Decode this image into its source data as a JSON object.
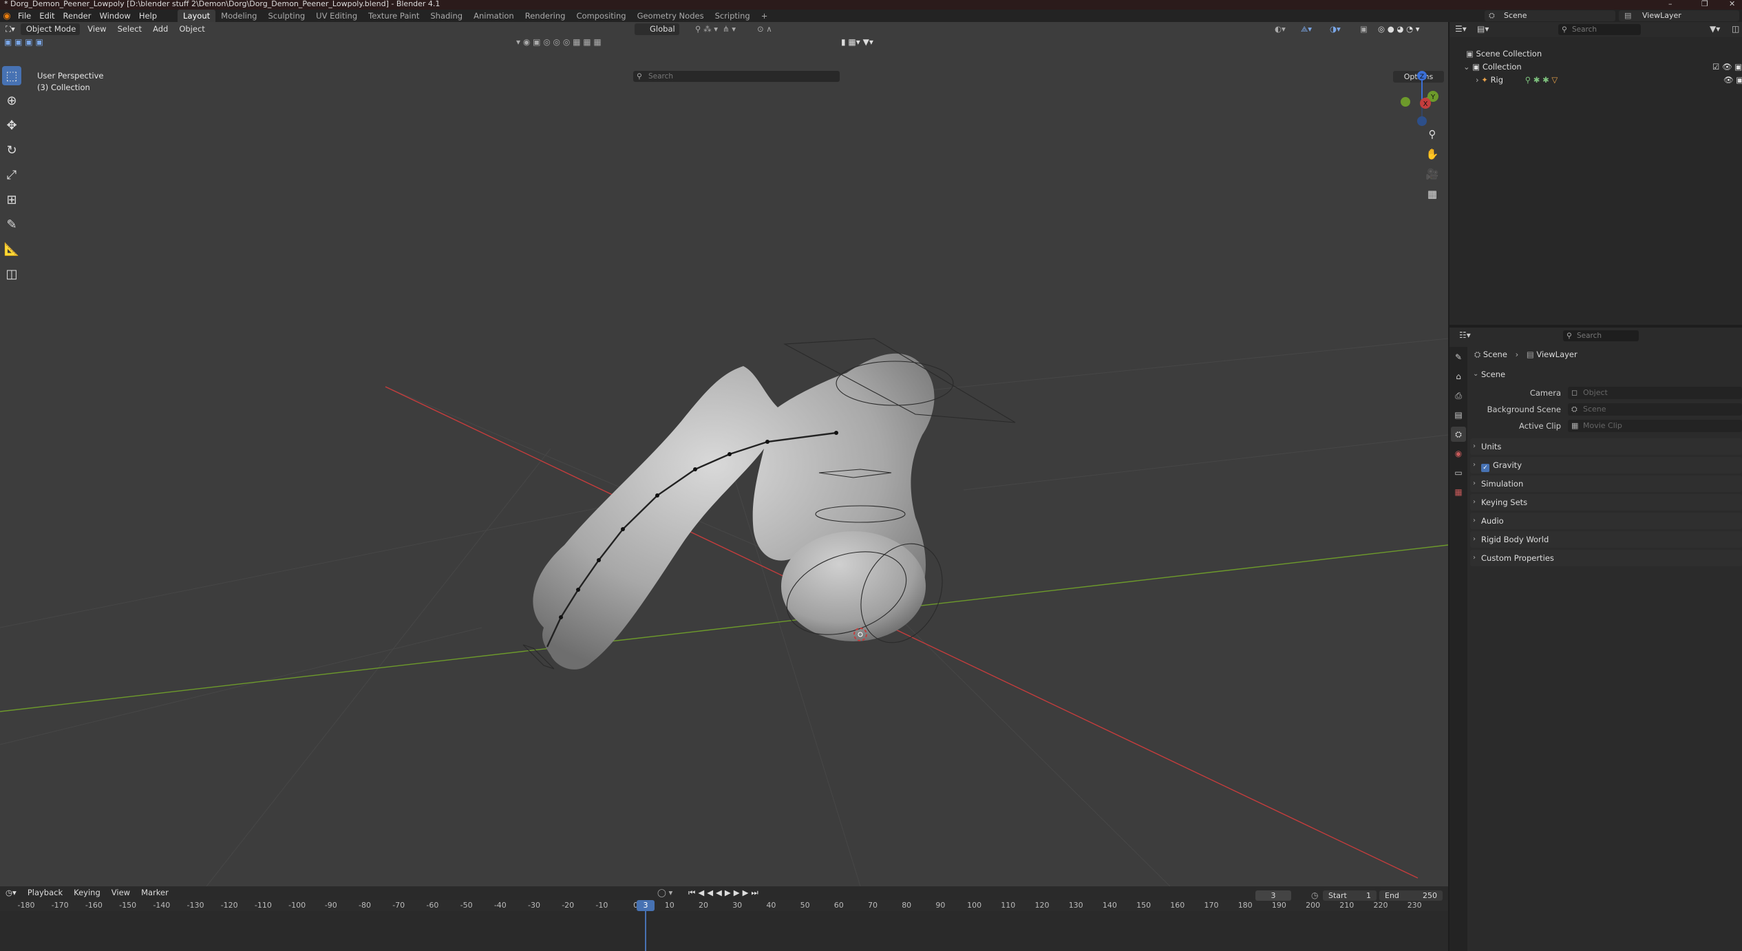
{
  "window": {
    "title": "* Dorg_Demon_Peener_Lowpoly [D:\\blender stuff 2\\Demon\\Dorg\\Dorg_Demon_Peener_Lowpoly.blend] - Blender 4.1",
    "controls": [
      "–",
      "❐",
      "✕"
    ]
  },
  "menus": [
    "File",
    "Edit",
    "Render",
    "Window",
    "Help"
  ],
  "workspaces": [
    {
      "label": "Layout",
      "active": true
    },
    {
      "label": "Modeling"
    },
    {
      "label": "Sculpting"
    },
    {
      "label": "UV Editing"
    },
    {
      "label": "Texture Paint"
    },
    {
      "label": "Shading"
    },
    {
      "label": "Animation"
    },
    {
      "label": "Rendering"
    },
    {
      "label": "Compositing"
    },
    {
      "label": "Geometry Nodes"
    },
    {
      "label": "Scripting"
    }
  ],
  "add_workspace": "+",
  "scene_selector": "Scene",
  "viewlayer_selector": "ViewLayer",
  "viewport": {
    "mode": "Object Mode",
    "menus": [
      "View",
      "Select",
      "Add",
      "Object"
    ],
    "transform_orientation": "Global",
    "search_placeholder": "Search",
    "options_label": "Options",
    "info_line1": "User Perspective",
    "info_line2": "(3) Collection",
    "gizmo": {
      "x": "X",
      "y": "Y",
      "z": "Z"
    },
    "colors": {
      "x_axis": "#c43d3d",
      "y_axis": "#6d9a2b",
      "bg": "#3d3d3d"
    }
  },
  "tools": [
    "select-box-icon",
    "cursor-icon",
    "move-icon",
    "rotate-icon",
    "scale-icon",
    "transform-icon",
    "annotate-icon",
    "measure-icon",
    "add-cube-icon"
  ],
  "timeline": {
    "menus": [
      "Playback",
      "Keying",
      "View",
      "Marker"
    ],
    "current_frame": "3",
    "start_label": "Start",
    "start_value": "1",
    "end_label": "End",
    "end_value": "250",
    "ticks": [
      "-180",
      "-170",
      "-160",
      "-150",
      "-140",
      "-130",
      "-120",
      "-110",
      "-100",
      "-90",
      "-80",
      "-70",
      "-60",
      "-50",
      "-40",
      "-30",
      "-20",
      "-10",
      "0",
      "10",
      "20",
      "30",
      "40",
      "50",
      "60",
      "70",
      "80",
      "90",
      "100",
      "110",
      "120",
      "130",
      "140",
      "150",
      "160",
      "170",
      "180",
      "190",
      "200",
      "210",
      "220",
      "230"
    ]
  },
  "outliner": {
    "search_placeholder": "Search",
    "rows": [
      {
        "label": "Scene Collection",
        "indent": 0
      },
      {
        "label": "Collection",
        "indent": 1
      },
      {
        "label": "Rig",
        "indent": 2
      }
    ]
  },
  "properties": {
    "search_placeholder": "Search",
    "breadcrumb": [
      "Scene",
      "ViewLayer"
    ],
    "panel_title": "Scene",
    "fields": [
      {
        "label": "Camera",
        "placeholder": "Object"
      },
      {
        "label": "Background Scene",
        "placeholder": "Scene"
      },
      {
        "label": "Active Clip",
        "placeholder": "Movie Clip"
      }
    ],
    "sections": [
      "Units",
      "Gravity",
      "Simulation",
      "Keying Sets",
      "Audio",
      "Rigid Body World",
      "Custom Properties"
    ],
    "gravity_checked": true
  }
}
